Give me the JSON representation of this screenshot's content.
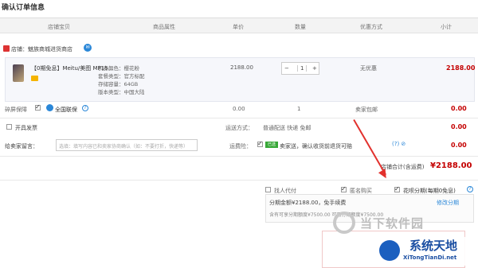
{
  "page_title": "确认订单信息",
  "header_columns": [
    "店铺宝贝",
    "商品属性",
    "单价",
    "数量",
    "优惠方式",
    "小计"
  ],
  "shop": {
    "label": "店铺：魅族商城进货商店"
  },
  "product": {
    "name": "【0期免息】Meitu/美图 MP15...",
    "specs": [
      "机身颜色：樱花粉",
      "套餐类型：官方标配",
      "存储容量：64GB",
      "版本类型：中国大陆"
    ],
    "price": "2188.00",
    "quantity": "1",
    "promotion": "无优惠",
    "subtotal": "2188.00"
  },
  "insurance": {
    "label": "碎屏保障",
    "option_label": "全国联保",
    "price": "0.00",
    "qty": "1",
    "promo": "卖家包邮",
    "subtotal": "0.00"
  },
  "invoice": {
    "label": "开具发票",
    "shipping_method_label": "运送方式：",
    "shipping_method_value": "普通配送 快递 免邮",
    "subtotal": "0.00"
  },
  "note": {
    "label": "给卖家留言：",
    "placeholder": "选填：填写内容已和卖家协商确认（如：不要打折，快递等）",
    "freight_label": "运费险：",
    "freight_badge": "已选",
    "freight_text": "卖家送，确认收货前退货可赔",
    "subtotal": "0.00"
  },
  "total": {
    "label": "店铺合计(含运费)",
    "value": "¥2188.00"
  },
  "payment_options": {
    "friend_pay": "找人代付",
    "anonymous": "匿名购买",
    "installment": "花呗分期(每期0免息)",
    "installment_info": "分期金额¥2188.00，免手续费",
    "installment_detail": "含有可享分期额度¥7500.00 可用分期额度¥7500.00",
    "change_link": "修改分期"
  },
  "watermarks": {
    "site1": "当下软件园",
    "site2_title": "系统天地",
    "site2_url": "XiTongTianDi.net"
  },
  "colors": {
    "price_red": "#c40000",
    "arrow_red": "#e2312d",
    "header_bg": "#f3f3f3",
    "link_blue": "#2a87d8"
  }
}
